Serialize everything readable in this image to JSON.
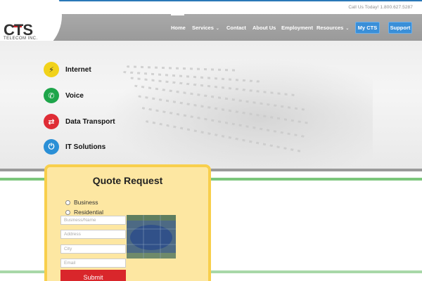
{
  "util": {
    "call_text": "Call Us Today! 1.800.627.5287"
  },
  "logo": {
    "name": "CTS",
    "sub": "TELECOM INC."
  },
  "nav": {
    "items": [
      {
        "label": "Home"
      },
      {
        "label": "Services",
        "chev": "⌄"
      },
      {
        "label": "Contact"
      },
      {
        "label": "About Us"
      },
      {
        "label": "Employment"
      },
      {
        "label": "Resources",
        "chev": "⌄"
      }
    ],
    "mycts": "My CTS",
    "support": "Support"
  },
  "services": [
    {
      "label": "Internet",
      "icon": "bolt-icon",
      "glyph": "⚡",
      "color": "#f1d21a"
    },
    {
      "label": "Voice",
      "icon": "phone-icon",
      "glyph": "✆",
      "color": "#1ea54a"
    },
    {
      "label": "Data Transport",
      "icon": "swap-arrows-icon",
      "glyph": "⇄",
      "color": "#df2c35"
    },
    {
      "label": "IT Solutions",
      "icon": "power-icon",
      "glyph": "⏻",
      "color": "#2a8fd6"
    }
  ],
  "quote": {
    "title": "Quote Request",
    "options": [
      "Business",
      "Residential"
    ],
    "fields": {
      "business": "Business/Name",
      "address": "Address",
      "city": "City",
      "email": "Email"
    },
    "submit": "Submit"
  }
}
